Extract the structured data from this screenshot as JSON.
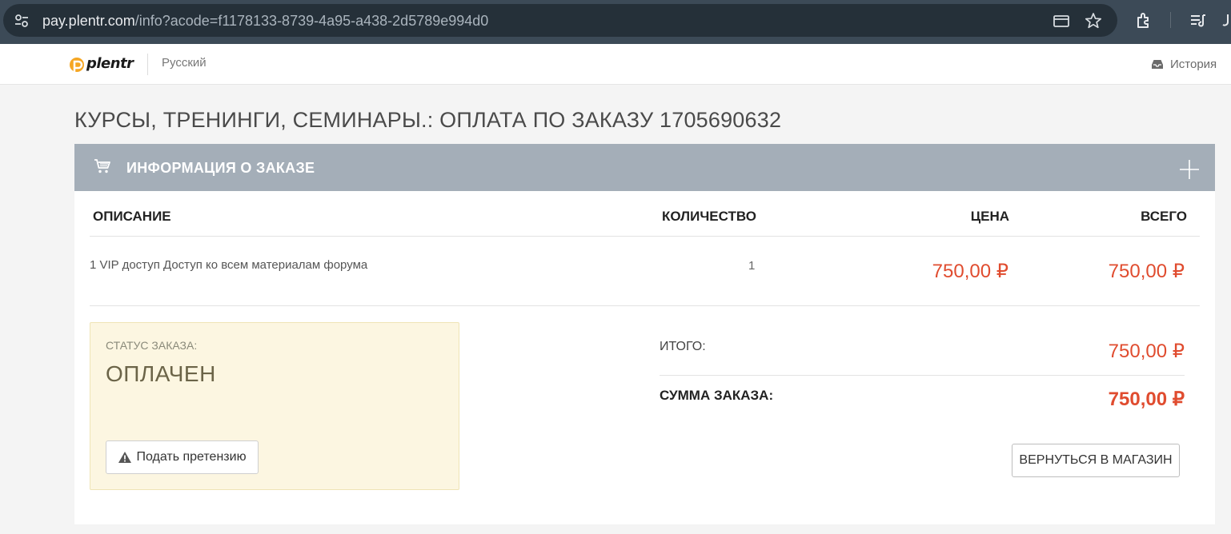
{
  "browser": {
    "url_host": "pay.plentr.com",
    "url_path": "/info?acode=f1178133-8739-4a95-a438-2d5789e994d0"
  },
  "header": {
    "logo_text": "plentr",
    "language": "Русский",
    "history_label": "История"
  },
  "page": {
    "title": "КУРСЫ, ТРЕНИНГИ, СЕМИНАРЫ.: ОПЛАТА ПО ЗАКАЗУ 1705690632"
  },
  "order_panel": {
    "title": "ИНФОРМАЦИЯ О ЗАКАЗЕ",
    "columns": {
      "description": "ОПИСАНИЕ",
      "quantity": "КОЛИЧЕСТВО",
      "price": "ЦЕНА",
      "total": "ВСЕГО"
    },
    "items": [
      {
        "description": "1 VIP доступ Доступ ко всем материалам форума",
        "quantity": "1",
        "price": "750,00 ₽",
        "total": "750,00 ₽"
      }
    ],
    "status": {
      "label": "СТАТУС ЗАКАЗА:",
      "value": "ОПЛАЧЕН",
      "claim_button": "Подать претензию"
    },
    "summary": {
      "subtotal_label": "ИТОГО:",
      "subtotal_value": "750,00 ₽",
      "order_sum_label": "СУММА ЗАКАЗА:",
      "order_sum_value": "750,00 ₽"
    },
    "back_button": "ВЕРНУТЬСЯ В МАГАЗИН"
  },
  "colors": {
    "accent_price": "#e04c2f",
    "panel_header": "#a4aeb8",
    "status_bg": "#fcf6e1"
  }
}
